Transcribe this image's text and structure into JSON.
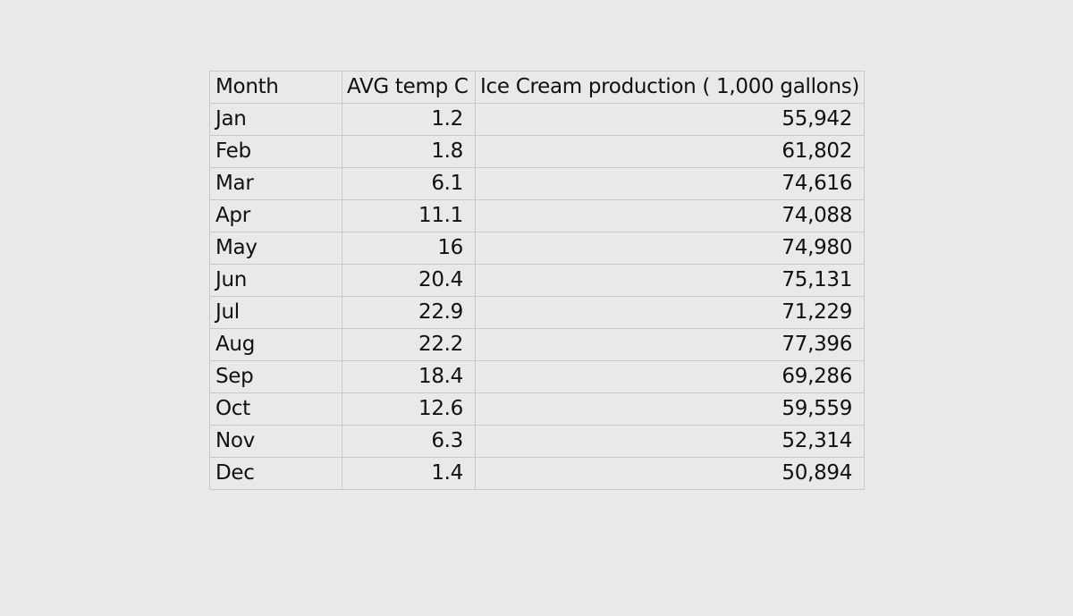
{
  "table": {
    "headers": {
      "month": "Month",
      "temp": "AVG temp C",
      "production": "Ice Cream production ( 1,000 gallons)"
    },
    "rows": [
      {
        "month": "Jan",
        "temp": "1.2",
        "production": "55,942"
      },
      {
        "month": "Feb",
        "temp": "1.8",
        "production": "61,802"
      },
      {
        "month": "Mar",
        "temp": "6.1",
        "production": "74,616"
      },
      {
        "month": "Apr",
        "temp": "11.1",
        "production": "74,088"
      },
      {
        "month": "May",
        "temp": "16",
        "production": "74,980"
      },
      {
        "month": "Jun",
        "temp": "20.4",
        "production": "75,131"
      },
      {
        "month": "Jul",
        "temp": "22.9",
        "production": "71,229"
      },
      {
        "month": "Aug",
        "temp": "22.2",
        "production": "77,396"
      },
      {
        "month": "Sep",
        "temp": "18.4",
        "production": "69,286"
      },
      {
        "month": "Oct",
        "temp": "12.6",
        "production": "59,559"
      },
      {
        "month": "Nov",
        "temp": "6.3",
        "production": "52,314"
      },
      {
        "month": "Dec",
        "temp": "1.4",
        "production": "50,894"
      }
    ]
  },
  "colors": {
    "background": "#e9e9e9",
    "gridline": "#c9c9c9",
    "text": "#111111"
  }
}
